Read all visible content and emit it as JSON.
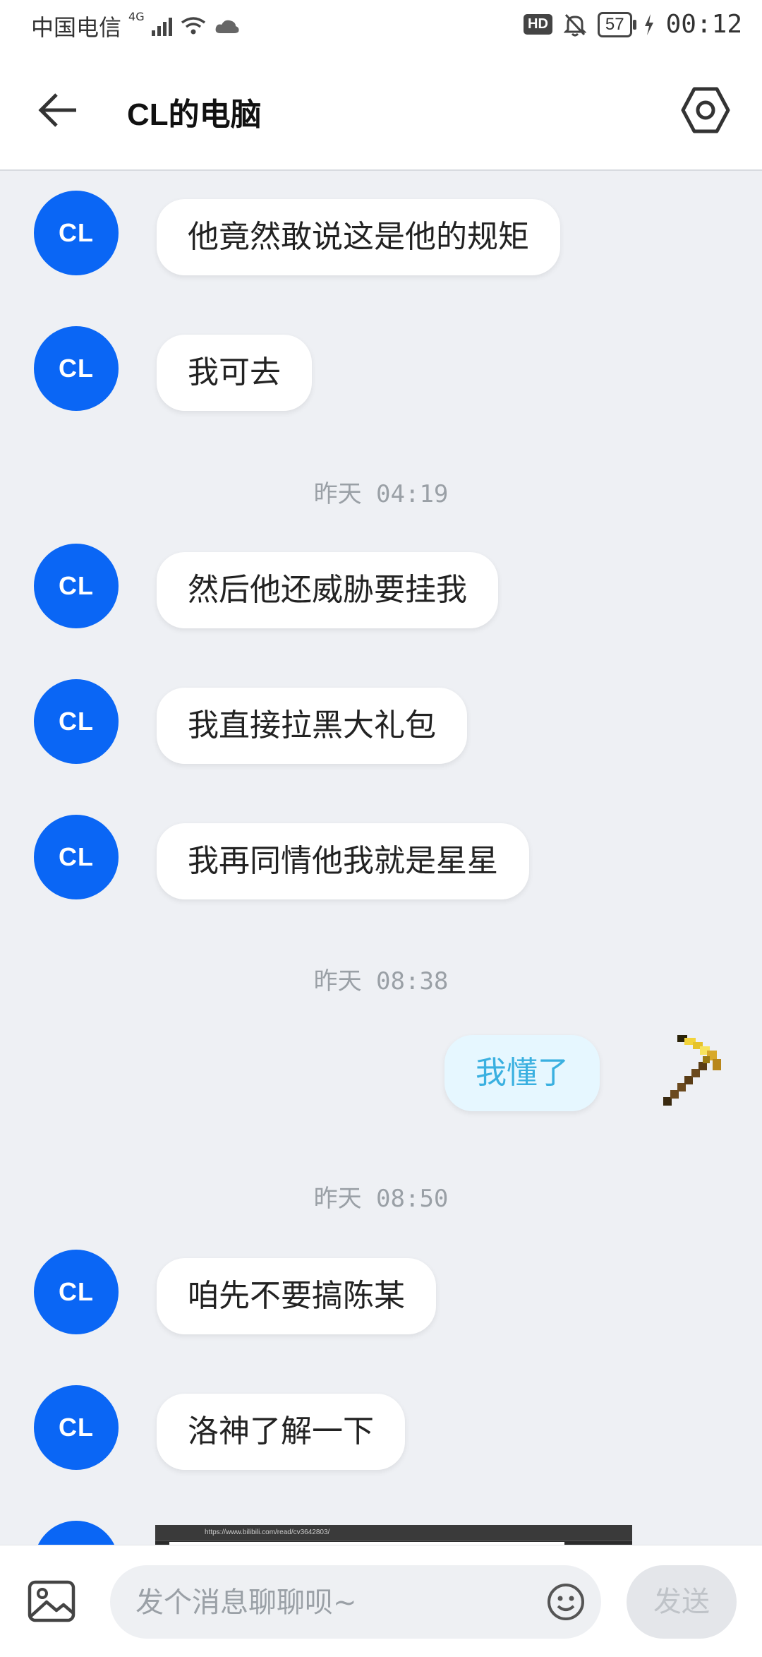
{
  "status_bar": {
    "carrier": "中国电信",
    "network": "4G",
    "battery": "57",
    "hd": "HD",
    "time": "00:12"
  },
  "header": {
    "title": "CL的电脑"
  },
  "avatar_label": "CL",
  "messages": [
    {
      "type": "incoming",
      "text": "他竟然敢说这是他的规矩"
    },
    {
      "type": "incoming",
      "text": "我可去"
    },
    {
      "type": "time",
      "text": "昨天 04:19"
    },
    {
      "type": "incoming",
      "text": "然后他还威胁要挂我"
    },
    {
      "type": "incoming",
      "text": "我直接拉黑大礼包"
    },
    {
      "type": "incoming",
      "text": "我再同情他我就是星星"
    },
    {
      "type": "time",
      "text": "昨天 08:38"
    },
    {
      "type": "outgoing",
      "text": "我懂了"
    },
    {
      "type": "time",
      "text": "昨天 08:50"
    },
    {
      "type": "incoming",
      "text": "咱先不要搞陈某"
    },
    {
      "type": "incoming",
      "text": "洛神了解一下"
    }
  ],
  "screenshot_url": "https://www.bilibili.com/read/cv3642803/",
  "input": {
    "placeholder": "发个消息聊聊呗~",
    "send_label": "发送"
  },
  "colors": {
    "avatar": "#0a66f5",
    "outgoing_bubble": "#e6f7ff",
    "outgoing_text": "#3ab0e0",
    "background": "#eef0f4"
  }
}
